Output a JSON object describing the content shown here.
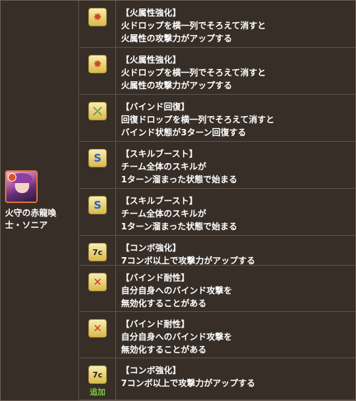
{
  "monster": {
    "name_line1": "火守の赤龍喚",
    "name_line2": "士・ソニア"
  },
  "awakenings": [
    {
      "icon": "fire-enhance-icon",
      "glyph": "✸",
      "kind": "fire",
      "title": "【火属性強化】",
      "lines": [
        "火ドロップを横一列でそろえて消すと",
        "火属性の攻撃力がアップする"
      ],
      "added": ""
    },
    {
      "icon": "fire-enhance-icon",
      "glyph": "✸",
      "kind": "fire",
      "title": "【火属性強化】",
      "lines": [
        "火ドロップを横一列でそろえて消すと",
        "火属性の攻撃力がアップする"
      ],
      "added": ""
    },
    {
      "icon": "bind-recovery-icon",
      "glyph": "⤫",
      "kind": "bind",
      "title": "【バインド回復】",
      "lines": [
        "回復ドロップを横一列でそろえて消すと",
        "バインド状態が3ターン回復する"
      ],
      "added": ""
    },
    {
      "icon": "skill-boost-icon",
      "glyph": "S",
      "kind": "skill",
      "title": "【スキルブースト】",
      "lines": [
        "チーム全体のスキルが",
        "1ターン溜まった状態で始まる"
      ],
      "added": ""
    },
    {
      "icon": "skill-boost-icon",
      "glyph": "S",
      "kind": "skill",
      "title": "【スキルブースト】",
      "lines": [
        "チーム全体のスキルが",
        "1ターン溜まった状態で始まる"
      ],
      "added": ""
    },
    {
      "icon": "combo-enhance-icon",
      "glyph": "7c",
      "kind": "combo",
      "title": "【コンボ強化】",
      "lines": [
        "7コンボ以上で攻撃力がアップする"
      ],
      "added": ""
    },
    {
      "icon": "bind-resist-icon",
      "glyph": "✕",
      "kind": "resist",
      "title": "【バインド耐性】",
      "lines": [
        "自分自身へのバインド攻撃を",
        "無効化することがある"
      ],
      "added": ""
    },
    {
      "icon": "bind-resist-icon",
      "glyph": "✕",
      "kind": "resist",
      "title": "【バインド耐性】",
      "lines": [
        "自分自身へのバインド攻撃を",
        "無効化することがある"
      ],
      "added": ""
    },
    {
      "icon": "combo-enhance-icon",
      "glyph": "7c",
      "kind": "combo",
      "title": "【コンボ強化】",
      "lines": [
        "7コンボ以上で攻撃力がアップする"
      ],
      "added": "追加"
    }
  ]
}
